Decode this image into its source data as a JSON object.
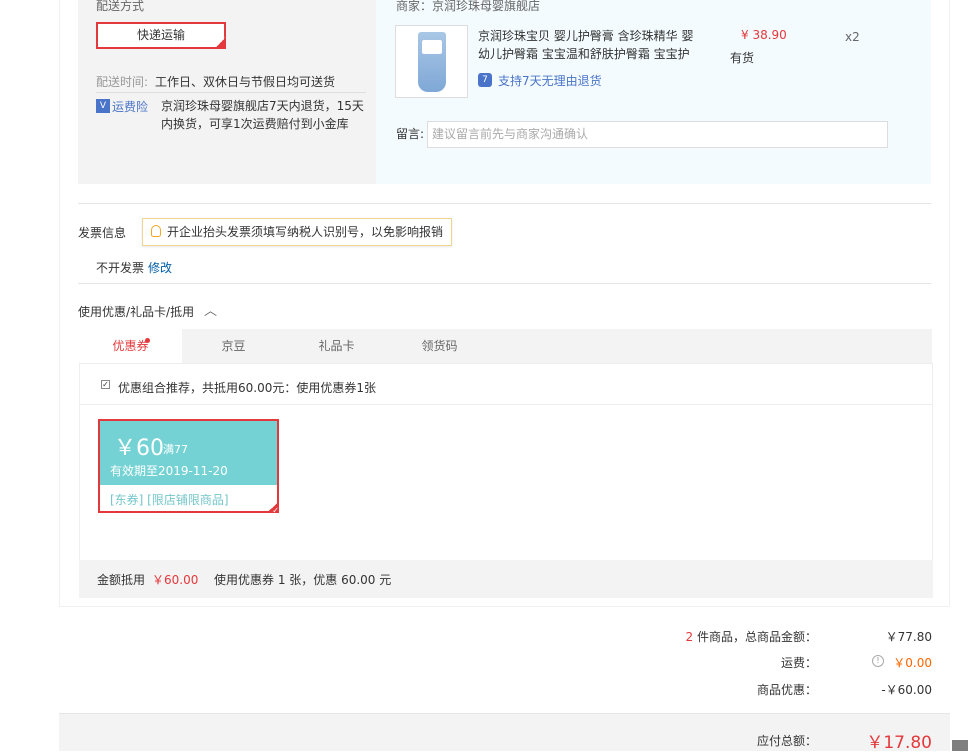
{
  "shipping": {
    "method_label": "配送方式",
    "method_option": "快递运输",
    "time_label": "配送时间:",
    "time_value": "工作日、双休日与节假日均可送货",
    "insurance_label": "运费险",
    "insurance_line1": "京润珍珠母婴旗舰店7天内退货，15天",
    "insurance_line2": "内换货，可享1次运费赔付到小金库"
  },
  "store": {
    "label": "商家：京润珍珠母婴旗舰店",
    "product_title_line1": "京润珍珠宝贝 婴儿护臀膏 含珍珠精华 婴",
    "product_title_line2": "幼儿护臀霜 宝宝温和舒肤护臀霜 宝宝护",
    "price": "¥ 38.90",
    "quantity": "x2",
    "stock": "有货",
    "return_policy": "支持7天无理由退货",
    "message_label": "留言:",
    "message_placeholder": "建议留言前先与商家沟通确认"
  },
  "invoice": {
    "label": "发票信息",
    "tip": "开企业抬头发票须填写纳税人识别号，以免影响报销",
    "value": "不开发票",
    "edit_link": "修改"
  },
  "discount": {
    "header": "使用优惠/礼品卡/抵用",
    "tabs": [
      "优惠券",
      "京豆",
      "礼品卡",
      "领货码"
    ],
    "recommend_text": "优惠组合推荐，共抵用60.00元：使用优惠券1张",
    "coupon": {
      "amount": "￥60",
      "condition": "满77",
      "validity": "有效期至2019-11-20",
      "tags": "[东券]  [限店铺限商品]"
    },
    "summary_label": "金额抵用",
    "summary_amount": "￥60.00",
    "summary_detail": "使用优惠券 1 张，优惠 60.00 元"
  },
  "totals": {
    "item_count": "2",
    "items_label": "件商品，总商品金额：",
    "items_amount": "￥77.80",
    "shipping_label": "运费：",
    "shipping_amount": "￥0.00",
    "discount_label": "商品优惠：",
    "discount_amount": "-￥60.00",
    "payable_label": "应付总额：",
    "payable_amount": "￥17.80"
  },
  "colors": {
    "accent": "#e4393c",
    "coupon": "#74d2d4",
    "link": "#005ea7"
  }
}
